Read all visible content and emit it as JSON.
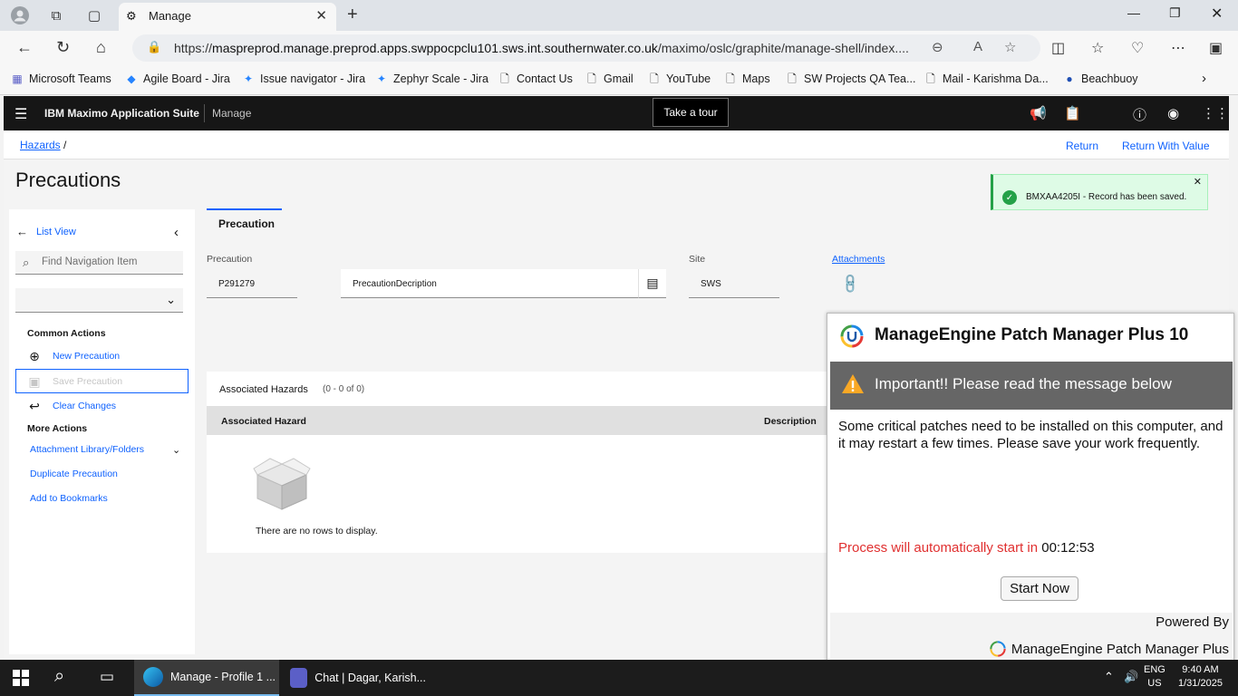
{
  "browser": {
    "tab_title": "Manage",
    "url_prefix": "https://",
    "url_host": "maspreprod.manage.preprod.apps.swppocpclu101.sws.int.southernwater.co.uk",
    "url_path": "/maximo/oslc/graphite/manage-shell/index....",
    "bookmarks": [
      {
        "label": "Microsoft Teams",
        "icon": "teams-icon"
      },
      {
        "label": "Agile Board - Jira",
        "icon": "jira-icon"
      },
      {
        "label": "Issue navigator - Jira",
        "icon": "jira-icon"
      },
      {
        "label": "Zephyr Scale - Jira",
        "icon": "jira-icon"
      },
      {
        "label": "Contact Us",
        "icon": "page-icon"
      },
      {
        "label": "Gmail",
        "icon": "page-icon"
      },
      {
        "label": "YouTube",
        "icon": "page-icon"
      },
      {
        "label": "Maps",
        "icon": "page-icon"
      },
      {
        "label": "SW Projects QA Tea...",
        "icon": "page-icon"
      },
      {
        "label": "Mail - Karishma Da...",
        "icon": "page-icon"
      },
      {
        "label": "Beachbuoy",
        "icon": "beachbuoy-icon"
      }
    ]
  },
  "maximo": {
    "brand": "IBM Maximo Application Suite",
    "app": "Manage",
    "tour_button": "Take a tour",
    "breadcrumb": {
      "link": "Hazards",
      "sep": "/"
    },
    "return": "Return",
    "return_with_value": "Return With Value",
    "page_title": "Precautions",
    "toast": {
      "message": "BMXAA4205I - Record has been saved.",
      "close": "✕"
    },
    "sidebar": {
      "list_view": "List View",
      "search_placeholder": "Find Navigation Item",
      "common_actions": "Common Actions",
      "new_precaution": "New Precaution",
      "save_precaution": "Save Precaution",
      "clear_changes": "Clear Changes",
      "more_actions": "More Actions",
      "attachment_library": "Attachment Library/Folders",
      "duplicate_precaution": "Duplicate Precaution",
      "add_to_bookmarks": "Add to Bookmarks"
    },
    "tab": "Precaution",
    "fields": {
      "precaution_label": "Precaution",
      "precaution_value": "P291279",
      "description_value": "PrecautionDecription",
      "site_label": "Site",
      "site_value": "SWS",
      "attachments": "Attachments"
    },
    "table": {
      "title": "Associated Hazards",
      "count": "(0 - 0 of 0)",
      "col_hazard": "Associated Hazard",
      "col_description": "Description",
      "empty": "There are no rows to display."
    }
  },
  "popup": {
    "title": "ManageEngine Patch Manager Plus 10",
    "banner": "Important!! Please read the message below",
    "message": "Some critical patches need to be installed on this computer, and it may restart a few times. Please save your work frequently.",
    "process_text": "Process will automatically start in",
    "timer": "00:12:53",
    "start_button": "Start Now",
    "powered_by": "Powered By",
    "brand": "ManageEngine Patch Manager Plus"
  },
  "taskbar": {
    "app1": "Manage - Profile 1 ...",
    "app2": "Chat | Dagar, Karish...",
    "lang1": "ENG",
    "lang2": "US",
    "time": "9:40 AM",
    "date": "1/31/2025"
  },
  "colors": {
    "accent": "#0f62fe",
    "header": "#161616",
    "success": "#24a148",
    "warning": "#e03030"
  }
}
